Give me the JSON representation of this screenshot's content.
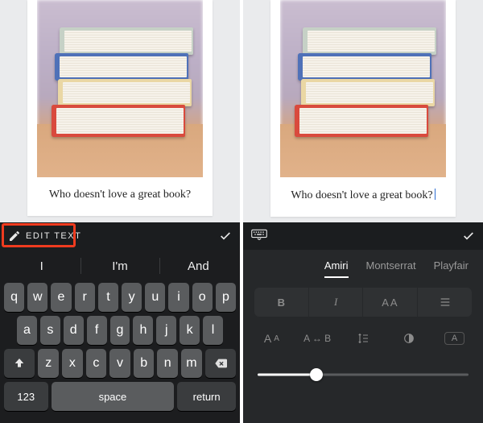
{
  "caption": "Who doesn't love a great book?",
  "edit_label": "EDIT TEXT",
  "suggestions": [
    "I",
    "I'm",
    "And"
  ],
  "keys_row1": [
    "q",
    "w",
    "e",
    "r",
    "t",
    "y",
    "u",
    "i",
    "o",
    "p"
  ],
  "keys_row2": [
    "a",
    "s",
    "d",
    "f",
    "g",
    "h",
    "j",
    "k",
    "l"
  ],
  "keys_row3": [
    "z",
    "x",
    "c",
    "v",
    "b",
    "n",
    "m"
  ],
  "key_123": "123",
  "key_space": "space",
  "key_return": "return",
  "fonts": {
    "items": [
      "Amiri",
      "Montserrat",
      "Playfair"
    ],
    "selected": 0
  },
  "style_seg": {
    "bold": "B",
    "italic": "I",
    "caps": "AA"
  },
  "tools": {
    "size": "Aᴀ",
    "hflip": "A ↔ B",
    "lineheight": "↕≡",
    "boxed": "A"
  },
  "slider": {
    "value": 28,
    "min": 0,
    "max": 100
  },
  "icons": {
    "pencil": "pencil-icon",
    "check": "check-icon",
    "shift": "shift-icon",
    "backspace": "backspace-icon",
    "keyboard": "keyboard-icon",
    "align": "align-icon",
    "contrast": "contrast-icon"
  }
}
